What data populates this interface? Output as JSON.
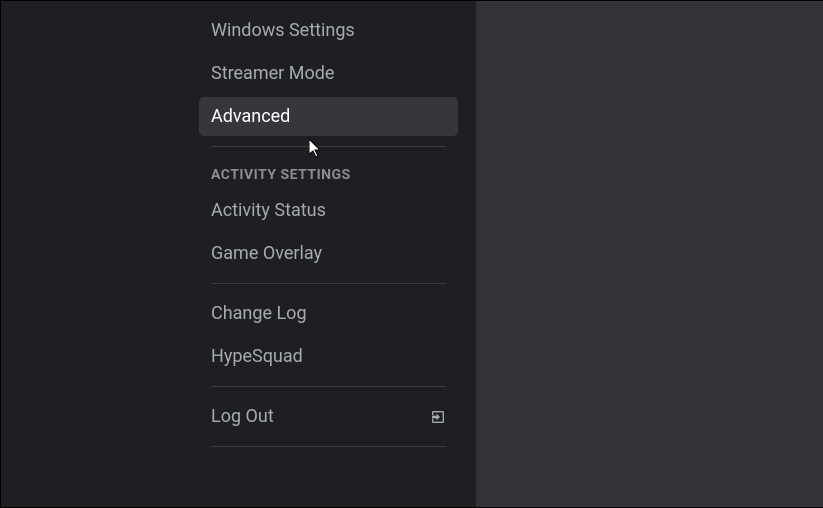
{
  "sidebar": {
    "items": [
      {
        "label": "Windows Settings"
      },
      {
        "label": "Streamer Mode"
      },
      {
        "label": "Advanced"
      }
    ],
    "section_header": "Activity Settings",
    "activity_items": [
      {
        "label": "Activity Status"
      },
      {
        "label": "Game Overlay"
      }
    ],
    "misc_items": [
      {
        "label": "Change Log"
      },
      {
        "label": "HypeSquad"
      }
    ],
    "logout_label": "Log Out"
  }
}
